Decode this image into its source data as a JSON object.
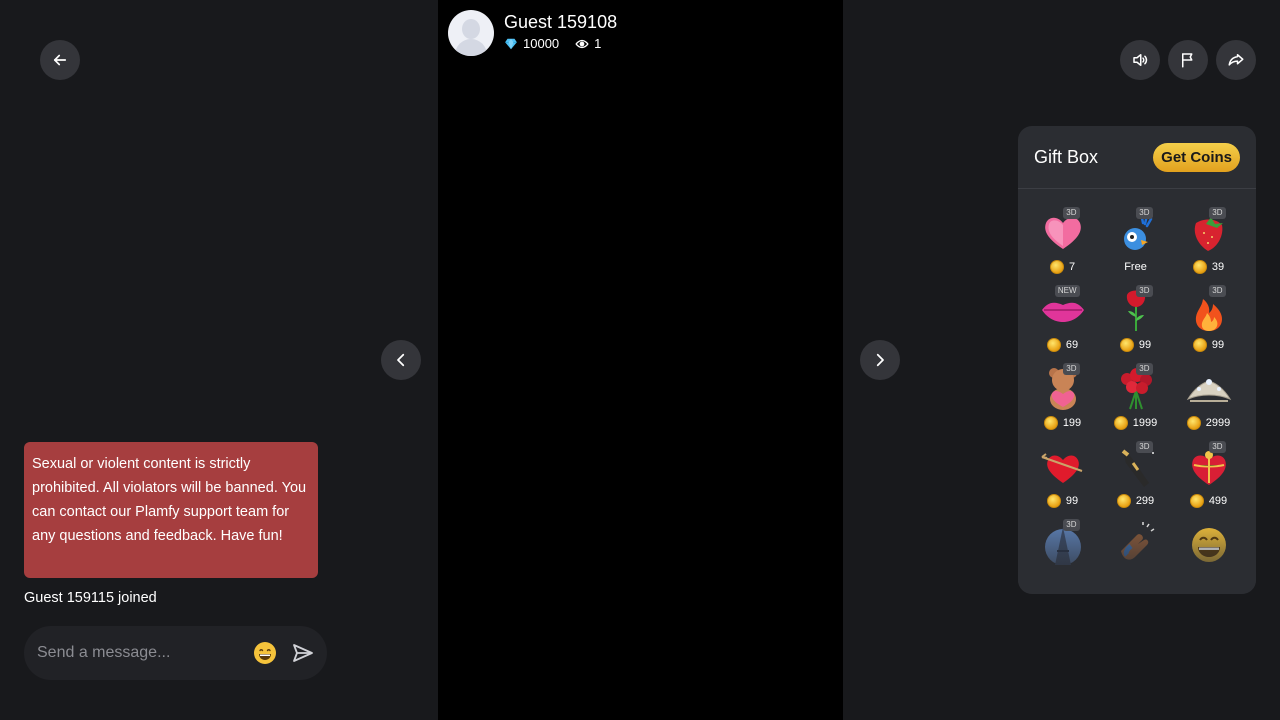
{
  "streamer": {
    "name": "Guest 159108",
    "diamonds": "10000",
    "viewers": "1"
  },
  "chat": {
    "notice": "Sexual or violent content is strictly prohibited. All violators will be banned. You can contact our Plamfy support team for any questions and feedback. Have fun!",
    "joined_message": "Guest 159115 joined",
    "input_placeholder": "Send a message...",
    "input_value": ""
  },
  "toolbar": {
    "icons": [
      "back-arrow-icon",
      "speaker-icon",
      "flag-icon",
      "share-icon"
    ]
  },
  "navigation": {
    "prev_icon": "chevron-left-icon",
    "next_icon": "chevron-right-icon"
  },
  "giftbox": {
    "title": "Gift Box",
    "get_coins_label": "Get Coins",
    "gifts": [
      {
        "name": "follow-me-heart",
        "badge": "3D",
        "price": "7",
        "free": false
      },
      {
        "name": "hi-parrot",
        "badge": "3D",
        "price": "Free",
        "free": true
      },
      {
        "name": "strawberry",
        "badge": "3D",
        "price": "39",
        "free": false
      },
      {
        "name": "lips",
        "badge": "NEW",
        "price": "69",
        "free": false
      },
      {
        "name": "rose",
        "badge": "3D",
        "price": "99",
        "free": false
      },
      {
        "name": "fire",
        "badge": "3D",
        "price": "99",
        "free": false
      },
      {
        "name": "love-you-bear",
        "badge": "3D",
        "price": "199",
        "free": false
      },
      {
        "name": "rose-bouquet",
        "badge": "3D",
        "price": "1999",
        "free": false
      },
      {
        "name": "tiara",
        "badge": "",
        "price": "2999",
        "free": false
      },
      {
        "name": "arrow-heart",
        "badge": "",
        "price": "99",
        "free": false
      },
      {
        "name": "champagne",
        "badge": "3D",
        "price": "299",
        "free": false
      },
      {
        "name": "heart-chocolate-box",
        "badge": "3D",
        "price": "499",
        "free": false
      },
      {
        "name": "eiffel-tower",
        "badge": "3D",
        "price": "",
        "free": false
      },
      {
        "name": "clapping-hands",
        "badge": "",
        "price": "",
        "free": false
      },
      {
        "name": "laughing-face",
        "badge": "",
        "price": "",
        "free": false
      }
    ]
  },
  "colors": {
    "background": "#18191c",
    "notice": "#a63e3f",
    "coin_gold": "#f0b428",
    "diamond": "#4fc3f7"
  }
}
